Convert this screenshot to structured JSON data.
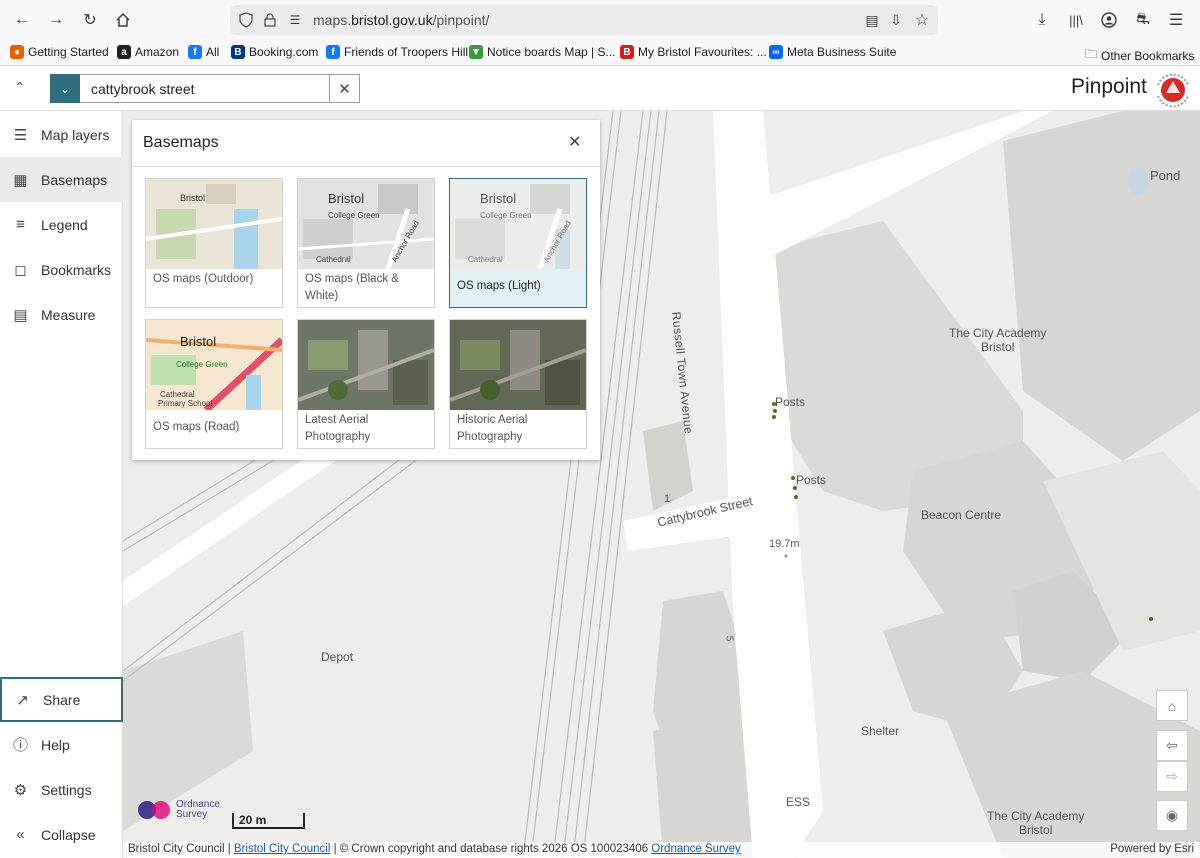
{
  "browser": {
    "url_prefix": "maps.",
    "url_domain": "bristol.gov.uk",
    "url_path": "/pinpoint/",
    "bookmarks": [
      {
        "label": "Getting Started",
        "icon": "firefox-icon",
        "color": "#e66000"
      },
      {
        "label": "Amazon",
        "icon": "amazon-icon",
        "color": "#222222"
      },
      {
        "label": "All",
        "icon": "facebook-icon",
        "color": "#1877f2"
      },
      {
        "label": "Booking.com",
        "icon": "booking-icon",
        "color": "#003580"
      },
      {
        "label": "Friends of Troopers Hill",
        "icon": "facebook-icon",
        "color": "#1877f2"
      },
      {
        "label": "Notice boards Map | S...",
        "icon": "map-pin-icon",
        "color": "#3a9a3a"
      },
      {
        "label": "My Bristol Favourites: ...",
        "icon": "bristol-icon",
        "color": "#d21f1f"
      },
      {
        "label": "Meta Business Suite",
        "icon": "meta-icon",
        "color": "#0866ff"
      }
    ],
    "other_bookmarks": "Other Bookmarks"
  },
  "app": {
    "search_value": "cattybrook street",
    "title": "Pinpoint",
    "logo_text": "BRISTOL CITY COUNCIL"
  },
  "sidebar": {
    "items": [
      {
        "label": "Map layers",
        "icon": "layers-icon"
      },
      {
        "label": "Basemaps",
        "icon": "grid-icon"
      },
      {
        "label": "Legend",
        "icon": "list-icon"
      },
      {
        "label": "Bookmarks",
        "icon": "bookmark-icon"
      },
      {
        "label": "Measure",
        "icon": "ruler-icon"
      }
    ],
    "bottom": [
      {
        "label": "Share",
        "icon": "share-icon"
      },
      {
        "label": "Help",
        "icon": "help-icon"
      },
      {
        "label": "Settings",
        "icon": "gear-icon"
      },
      {
        "label": "Collapse",
        "icon": "collapse-icon"
      }
    ]
  },
  "basemaps": {
    "title": "Basemaps",
    "cards": [
      {
        "label": "OS maps (Outdoor)",
        "thumb_text": "Bristol",
        "selected": false
      },
      {
        "label": "OS maps (Black & White)",
        "thumb_text": "Bristol",
        "selected": false
      },
      {
        "label": "OS maps (Light)",
        "thumb_text": "Bristol",
        "selected": true
      },
      {
        "label": "OS maps (Road)",
        "thumb_text": "Bristol",
        "selected": false
      },
      {
        "label": "Latest Aerial Photography",
        "thumb_text": "",
        "selected": false
      },
      {
        "label": "Historic Aerial Photography",
        "thumb_text": "",
        "selected": false
      }
    ],
    "thumb_sublabels": {
      "green": "College Green",
      "cathedral": "Cathedral",
      "road": "Anchor Road",
      "school": "Primary School"
    }
  },
  "map": {
    "labels": {
      "pond": "Pond",
      "academy1": "The City Academy\nBristol",
      "posts1": "Posts",
      "posts2": "Posts",
      "russell": "Russell Town Avenue",
      "cattybrook": "Cattybrook Street",
      "beacon": "Beacon Centre",
      "depot": "Depot",
      "shelter": "Shelter",
      "ess": "ESS",
      "academy2": "The City Academy\nBristol",
      "height": "19.7m",
      "num1": "1",
      "num5": "5"
    },
    "scale_label": "20 m",
    "os_logo_text": "Ordnance\nSurvey"
  },
  "footer": {
    "text1": "Bristol City Council | ",
    "link1": "Bristol City Council",
    "text2": " | © Crown copyright and database rights 2026 OS 100023406 ",
    "link2": "Ordnance Survey",
    "powered": "Powered by Esri"
  }
}
